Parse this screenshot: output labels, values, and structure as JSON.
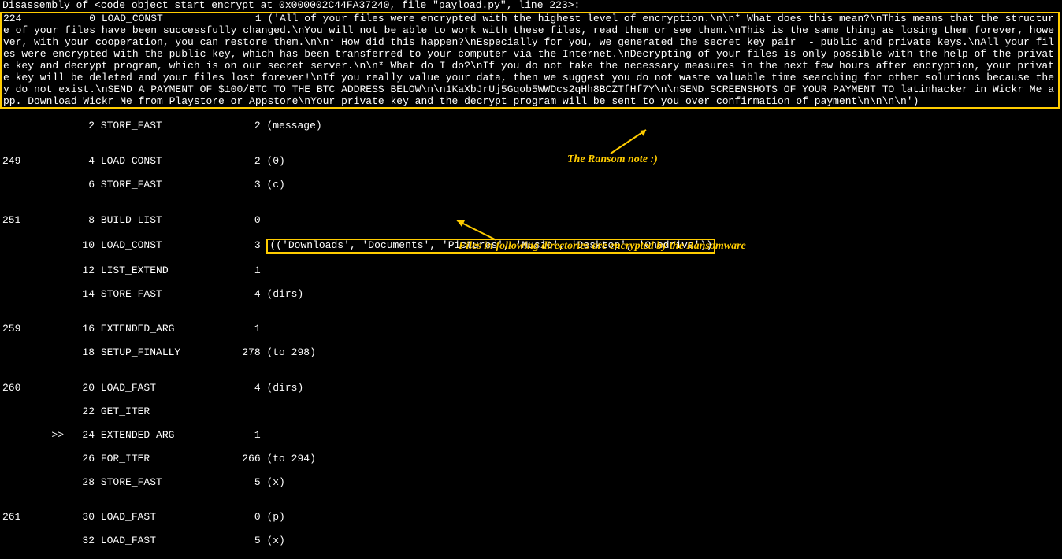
{
  "header": "Disassembly of <code object start_encrypt at 0x000002C44FA37240, file \"payload.py\", line 223>:",
  "ransom_note": "224           0 LOAD_CONST               1 ('All of your files were encrypted with the highest level of encryption.\\n\\n* What does this mean?\\nThis means that the structure of your files have been successfully changed.\\nYou will not be able to work with these files, read them or see them.\\nThis is the same thing as losing them forever, however, with your cooperation, you can restore them.\\n\\n* How did this happen?\\nEspecially for you, we generated the secret key pair  - public and private keys.\\nAll your files were encrypted with the public key, which has been transferred to your computer via the Internet.\\nDecrypting of your files is only possible with the help of the private key and decrypt program, which is on our secret server.\\n\\n* What do I do?\\nIf you do not take the necessary measures in the next few hours after encryption, your private key will be deleted and your files lost forever!\\nIf you really value your data, then we suggest you do not waste valuable time searching for other solutions because they do not exist.\\nSEND A PAYMENT OF $100/BTC TO THE BTC ADDRESS BELOW\\n\\n1KaXbJrUj5Gqob5WWDcs2qHh8BCZTfHf7Y\\n\\nSEND SCREENSHOTS OF YOUR PAYMENT TO latinhacker in Wickr Me app. Download Wickr Me from Playstore or Appstore\\nYour private key and the decrypt program will be sent to you over confirmation of payment\\n\\n\\n\\n')",
  "lines": {
    "l1": "              2 STORE_FAST               2 (message)",
    "l2": "",
    "l3": "249           4 LOAD_CONST               2 (0)",
    "l4": "              6 STORE_FAST               3 (c)",
    "l5": "",
    "l6": "251           8 BUILD_LIST               0",
    "l7a": "             10 LOAD_CONST               3 ",
    "l7b": "(('Downloads', 'Documents', 'Pictures', 'Music', 'Desktop', 'Onedrive'))",
    "l8": "             12 LIST_EXTEND              1",
    "l9": "             14 STORE_FAST               4 (dirs)",
    "l10": "",
    "l11": "259          16 EXTENDED_ARG             1",
    "l12": "             18 SETUP_FINALLY          278 (to 298)",
    "l13": "",
    "l14": "260          20 LOAD_FAST                4 (dirs)",
    "l15": "             22 GET_ITER",
    "l16": "        >>   24 EXTENDED_ARG             1",
    "l17": "             26 FOR_ITER               266 (to 294)",
    "l18": "             28 STORE_FAST               5 (x)",
    "l19": "",
    "l20": "261          30 LOAD_FAST                0 (p)",
    "l21": "             32 LOAD_FAST                5 (x)"
  },
  "annotations": {
    "ransom": "The Ransom note :)",
    "dirs": "Files in following directories are encrypted by the Ransomware"
  }
}
